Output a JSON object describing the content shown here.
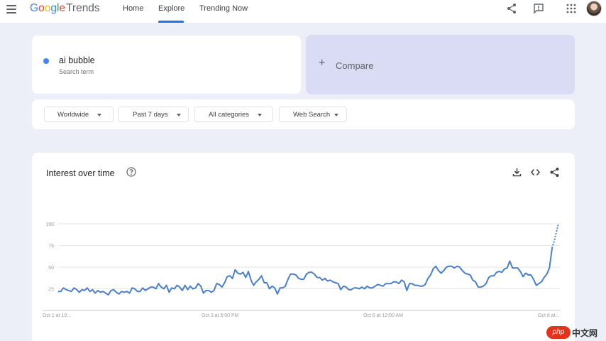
{
  "app": {
    "logo_google": "Google",
    "logo_trends": "Trends",
    "nav_tabs": [
      {
        "label": "Home"
      },
      {
        "label": "Explore"
      },
      {
        "label": "Trending Now"
      }
    ],
    "active_tab": "Explore",
    "icons": [
      "menu-icon",
      "share-icon",
      "feedback-icon",
      "apps-grid-icon",
      "avatar"
    ]
  },
  "search": {
    "term": "ai bubble",
    "term_type": "Search term",
    "term_color": "#4285f4",
    "compare_label": "Compare"
  },
  "filters": {
    "region": "Worldwide",
    "time_range": "Past 7 days",
    "category": "All categories",
    "search_type": "Web Search"
  },
  "chart_card": {
    "title": "Interest over time",
    "icons": [
      "help-icon",
      "download-icon",
      "embed-icon",
      "share-icon"
    ]
  },
  "chart_data": {
    "type": "line",
    "title": "Interest over time",
    "y_ticks": [
      "100",
      "75",
      "50",
      "25"
    ],
    "ylim": [
      0,
      100
    ],
    "x_tick_labels": [
      "Oct 1 at 10...",
      "Oct 3 at 5:00 PM",
      "Oct 6 at 12:00 AM",
      "Oct 8 at..."
    ],
    "grid": true,
    "series": [
      {
        "color": "#4a7fca",
        "values": [
          22,
          22,
          26,
          24,
          23,
          22,
          26,
          24,
          21,
          24,
          23,
          26,
          22,
          24,
          20,
          23,
          21,
          22,
          20,
          18,
          23,
          24,
          21,
          19,
          22,
          21,
          22,
          20,
          26,
          25,
          22,
          22,
          26,
          23,
          25,
          27,
          27,
          25,
          31,
          27,
          25,
          29,
          21,
          26,
          25,
          29,
          27,
          23,
          29,
          24,
          28,
          25,
          26,
          31,
          28,
          20,
          23,
          23,
          21,
          23,
          31,
          30,
          27,
          32,
          39,
          40,
          37,
          47,
          43,
          42,
          44,
          38,
          45,
          35,
          29,
          33,
          36,
          40,
          32,
          32,
          25,
          28,
          26,
          19,
          26,
          26,
          28,
          36,
          42,
          42,
          41,
          37,
          36,
          36,
          42,
          44,
          44,
          42,
          38,
          38,
          35,
          37,
          34,
          35,
          33,
          32,
          31,
          24,
          28,
          27,
          24,
          24,
          26,
          26,
          25,
          27,
          25,
          28,
          26,
          26,
          28,
          30,
          29,
          28,
          31,
          31,
          31,
          33,
          33,
          31,
          35,
          33,
          23,
          31,
          31,
          29,
          29,
          28,
          28,
          30,
          37,
          41,
          48,
          51,
          46,
          43,
          46,
          50,
          51,
          51,
          49,
          51,
          50,
          46,
          43,
          42,
          41,
          35,
          33,
          27,
          27,
          28,
          31,
          38,
          40,
          40,
          44,
          45,
          44,
          48,
          49,
          57,
          49,
          49,
          49,
          45,
          39,
          43,
          41,
          41,
          36,
          29,
          31,
          33,
          38,
          42,
          49,
          72
        ],
        "partial_values": [
          72,
          80,
          90,
          100
        ]
      }
    ]
  },
  "watermark": {
    "badge": "php",
    "text": "中文网"
  }
}
